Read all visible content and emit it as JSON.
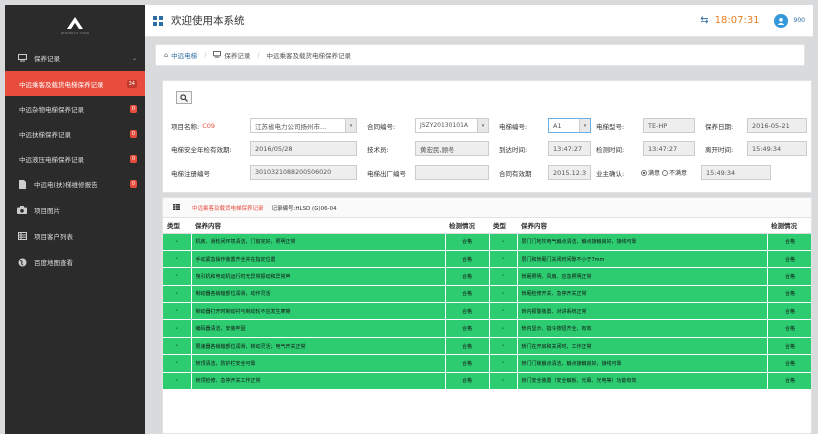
{
  "sidebar": {
    "logo_sub": "ZHONGYU YUAN",
    "items": [
      {
        "label": "保养记录",
        "icon": "monitor-icon",
        "expanded": true
      },
      {
        "label": "中远乘客及载货电梯保养记录",
        "badge": "34",
        "active": true
      },
      {
        "label": "中远杂物电梯保养记录",
        "badge": "0"
      },
      {
        "label": "中远扶梯保养记录",
        "badge": "0"
      },
      {
        "label": "中远液压电梯保养记录",
        "badge": "0"
      },
      {
        "label": "中远电(扶)梯维修报告",
        "badge": "0",
        "icon": "document-icon"
      },
      {
        "label": "项目图片",
        "icon": "camera-icon"
      },
      {
        "label": "项目客户列表",
        "icon": "list-icon"
      },
      {
        "label": "百度地图查看",
        "icon": "globe-icon"
      }
    ]
  },
  "header": {
    "title": "欢迎使用本系统",
    "time": "18:07:31",
    "user": "900"
  },
  "breadcrumb": {
    "home": "中远电梯",
    "level1": "保养记录",
    "current": "中远乘客及载货电梯保养记录"
  },
  "form": {
    "project_name_label": "项目名称:",
    "project_code": "C09",
    "project_name_value": "江苏省电力公司扬州市...",
    "contract_no_label": "合同编号:",
    "contract_no_value": "JSZY20130101A",
    "elevator_no_label": "电梯编号:",
    "elevator_no_value": "A1",
    "elevator_model_label": "电梯型号:",
    "elevator_model_value": "TE-HP",
    "maint_date_label": "保养日期:",
    "maint_date_value": "2016-05-21",
    "safety_check_label": "电梯安全年检有效期:",
    "safety_check_value": "2016/05/28",
    "technician_label": "技术员:",
    "technician_value": "黄宏民,顾冬",
    "arrive_label": "到达时间:",
    "arrive_value": "13:47:27",
    "check_label": "检测时间:",
    "check_value": "13:47:27",
    "leave_label": "离开时间:",
    "leave_value": "15:49:34",
    "reg_no_label": "电梯注册编号",
    "reg_no_value": "3010321088200506020",
    "factory_no_label": "电梯出厂编号",
    "factory_no_value": "",
    "contract_valid_label": "合同有效期",
    "contract_valid_value": "2015.12.3",
    "owner_confirm_label": "业主确认:",
    "satisfied": "满意",
    "unsatisfied": "不满意",
    "confirm_time": "15:49:34"
  },
  "record": {
    "title": "中远乘客及载货电梯保养记录",
    "number": "记录编号:HLSD (G)06-04",
    "headers": {
      "type": "类型",
      "content": "保养内容",
      "status": "检测情况"
    },
    "left": [
      "机房、滑轮间环境清洁，门窗完好，照明正常",
      "手动紧急操作装置齐全并在指定位置",
      "曳引机和电动机运行时无异常振动和异常声",
      "制动器各销轴部位润滑，动作灵活",
      "制动器打开时制动衬与制动轮不应发生摩擦",
      "编码器清洁，安装牢固",
      "限速器各销轴部位润滑，转动灵活；电气开关正常",
      "轿顶清洁，防护栏安全可靠",
      "轿顶检修、急停开关工作正常"
    ],
    "right": [
      "层门门地坎电气触点清洁，触点接触良好，接线可靠",
      "层门和轿厢门关闭时间隙不小于7mm",
      "轿厢照明、风扇、应急照明正常",
      "轿厢检修开关、急停开关正常",
      "轿内报警装置、对讲系统正常",
      "轿内显示、指令按钮齐全、有效",
      "轿门在开启和关闭时，工作正常",
      "轿门门锁触点清洁，触点接触良好，接线可靠",
      "轿门安全装置（安全触板、光幕、光电等）功能有效"
    ],
    "status": "合格"
  }
}
